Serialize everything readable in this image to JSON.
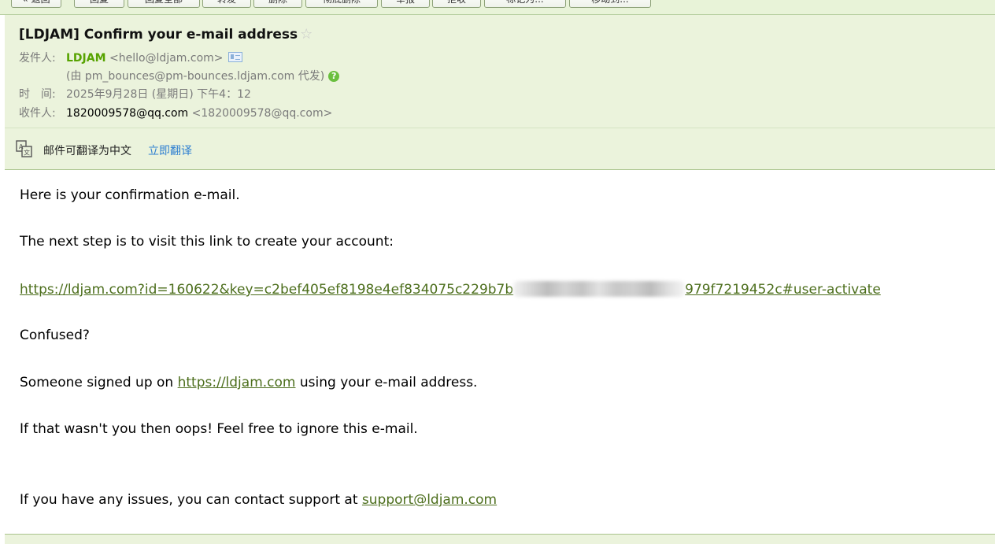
{
  "toolbar": {
    "buttons": [
      "« 返回",
      "回复",
      "回复全部",
      "转发",
      "删除",
      "彻底删除",
      "举报",
      "拒收",
      "标记为...",
      "移动到..."
    ]
  },
  "email": {
    "subject": "[LDJAM] Confirm your e-mail address",
    "from_label": "发件人:",
    "from_name": "LDJAM",
    "from_addr": "<hello@ldjam.com>",
    "on_behalf": "(由 pm_bounces@pm-bounces.ldjam.com 代发)",
    "time_label": "时　间:",
    "time_value": "2025年9月28日 (星期日) 下午4：12",
    "to_label": "收件人:",
    "to_name": "1820009578@qq.com",
    "to_addr": "<1820009578@qq.com>"
  },
  "translate": {
    "text": "邮件可翻译为中文",
    "link": "立即翻译"
  },
  "body": {
    "line1": "Here is your confirmation e-mail.",
    "line2": "The next step is to visit this link to create your account:",
    "link_start": "https://ldjam.com?id=160622&key=c2bef405ef8198e4ef834075c229b7b",
    "link_end": "979f7219452c#user-activate",
    "line3": "Confused?",
    "line4_pre": "Someone signed up on ",
    "line4_link": "https://ldjam.com",
    "line4_post": " using your e-mail address.",
    "line5": "If that wasn't you then oops! Feel free to ignore this e-mail.",
    "line6_pre": "If you have any issues, you can contact support at ",
    "line6_link": "support@ldjam.com"
  },
  "colors": {
    "header_bg": "#ebf3dc",
    "sender_green": "#57a300",
    "link_green": "#4c6e1c",
    "translate_blue": "#2e7fd1"
  }
}
